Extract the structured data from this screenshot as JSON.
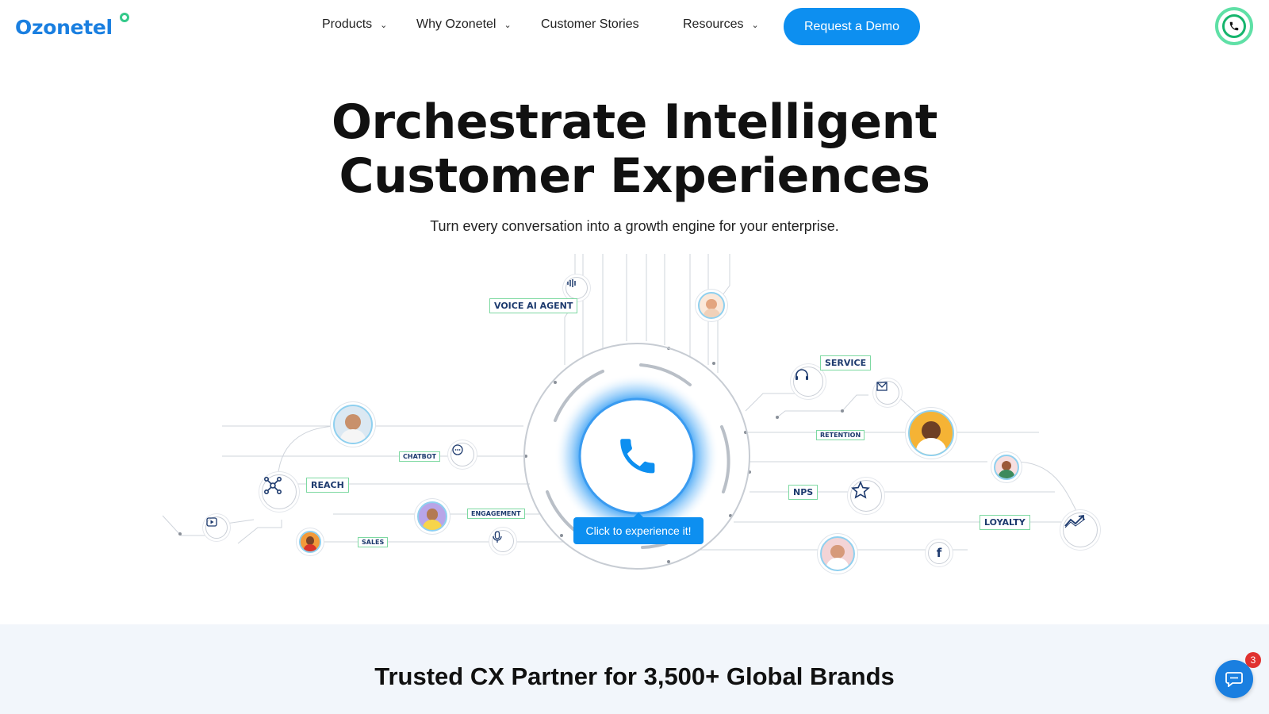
{
  "header": {
    "logo_text": "Ozonetel",
    "nav": [
      {
        "label": "Products",
        "has_dropdown": true
      },
      {
        "label": "Why Ozonetel",
        "has_dropdown": true
      },
      {
        "label": "Customer Stories",
        "has_dropdown": false
      },
      {
        "label": "Resources",
        "has_dropdown": true
      }
    ],
    "cta_label": "Request a Demo",
    "call_icon": "phone-icon"
  },
  "hero": {
    "title_line1": "Orchestrate Intelligent",
    "title_line2": "Customer Experiences",
    "subtitle": "Turn every conversation into a growth engine for your enterprise."
  },
  "diagram": {
    "tags": {
      "voice_ai_agent": "VOICE AI AGENT",
      "service": "SERVICE",
      "retention": "RETENTION",
      "chatbot": "CHATBOT",
      "reach": "REACH",
      "nps": "NPS",
      "engagement": "ENGAGEMENT",
      "loyalty": "LOYALTY",
      "sales": "SALES"
    },
    "cta_label": "Click to experience it!",
    "center_icon": "phone-icon"
  },
  "trusted": {
    "title": "Trusted CX Partner for 3,500+ Global Brands"
  },
  "chat_widget": {
    "badge_count": "3",
    "icon": "chat-icon"
  },
  "colors": {
    "brand_blue": "#0d8ff0",
    "logo_blue": "#1a7fe0",
    "accent_green": "#34c98a",
    "band_bg": "#f2f6fb"
  }
}
